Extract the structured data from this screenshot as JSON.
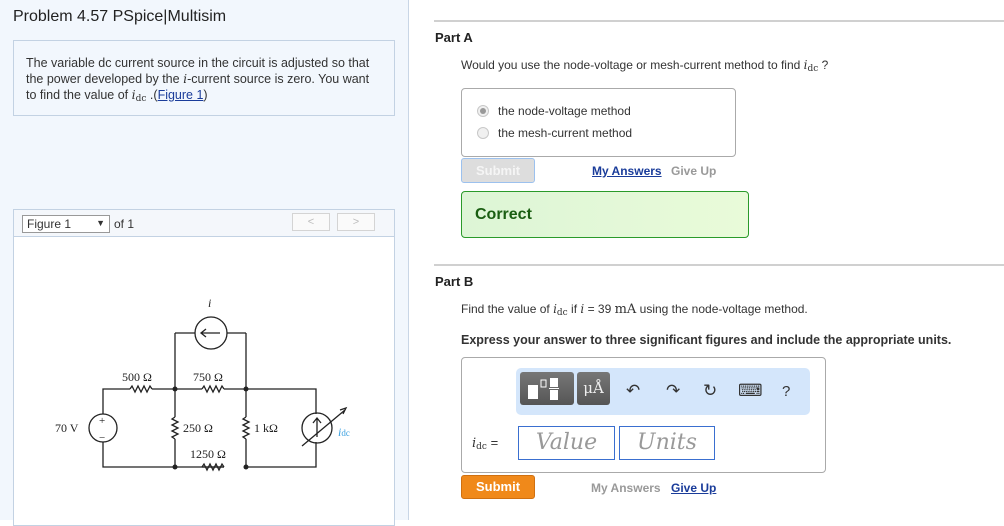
{
  "title": "Problem 4.57 PSpice|Multisim",
  "intro": {
    "text1": "The variable dc current source in the circuit is adjusted so that the power developed by the ",
    "i": "i",
    "text2": "-current source is zero. You want to find the value of ",
    "idc_i": "i",
    "idc_sub": "dc",
    "text3": " .(",
    "link": "Figure 1",
    "text4": ")"
  },
  "figure": {
    "selected": "Figure 1",
    "of": "of 1",
    "prev": "<",
    "next": ">",
    "labels": {
      "i": "i",
      "r500": "500 Ω",
      "r750": "750 Ω",
      "r250": "250 Ω",
      "r1k": "1 kΩ",
      "r1250": "1250 Ω",
      "v70": "70 V",
      "plus": "+",
      "minus": "−",
      "idc_i": "i",
      "idc_sub": "dc"
    }
  },
  "partA": {
    "label": "Part A",
    "q1": "Would you use the node-voltage or mesh-current method to find ",
    "q_i": "i",
    "q_sub": "dc",
    "q2": " ?",
    "options": [
      "the node-voltage method",
      "the mesh-current method"
    ],
    "selected": 0,
    "submit": "Submit",
    "my_answers": "My Answers",
    "give_up": "Give Up",
    "result": "Correct"
  },
  "partB": {
    "label": "Part B",
    "q1": "Find the value of ",
    "q_i": "i",
    "q_sub": "dc",
    "q2": "  if ",
    "q_i2": "i",
    "q3": " = 39 ",
    "q_unit": "mA",
    "q4": " using the node-voltage method.",
    "instruction": "Express your answer to three significant figures and include the appropriate units.",
    "toolbar": {
      "units": "μÅ",
      "undo": "↶",
      "redo": "↷",
      "reset": "↻",
      "keyboard": "⌨",
      "help": "?"
    },
    "var_i": "i",
    "var_sub": "dc",
    "eq": "=",
    "value_placeholder": "Value",
    "units_placeholder": "Units",
    "submit": "Submit",
    "my_answers": "My Answers",
    "give_up": "Give Up"
  },
  "colors": {
    "accent": "#f0891a",
    "correct_border": "#2a9a2a",
    "idc_label": "#3aa0e0"
  }
}
